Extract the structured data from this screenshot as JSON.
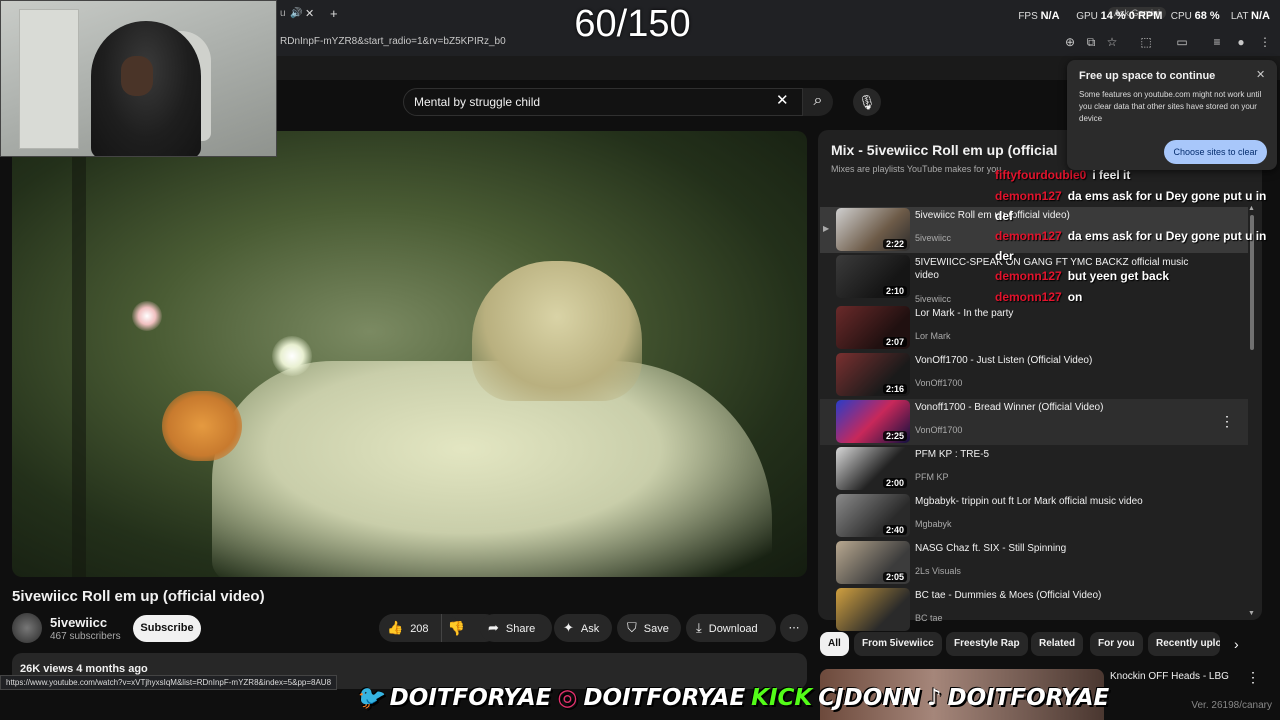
{
  "browser": {
    "url": "RDnInpF-mYZR8&start_radio=1&rv=bZ5KPIRz_b0",
    "tab_partial": "u",
    "status_url": "https://www.youtube.com/watch?v=xVTjhyxsIqM&list=RDnInpF-mYZR8&index=5&pp=8AU8"
  },
  "overlay": {
    "counter": "60/150",
    "ask_gemini": "Ask Gemini",
    "fps_label": "FPS",
    "fps_value": "N/A",
    "gpu_label": "GPU",
    "gpu_value": "14 % 0 RPM",
    "cpu_label": "CPU",
    "cpu_value": "68 %",
    "lat_label": "LAT",
    "lat_value": "N/A",
    "version": "Ver. 26198/canary",
    "socials": [
      {
        "icon": "twitter-icon",
        "glyph": "🐦",
        "text": "DOITFORYAE"
      },
      {
        "icon": "instagram-icon",
        "glyph": "◎",
        "text": "DOITFORYAE"
      },
      {
        "icon": "kick-icon",
        "glyph": "KICK",
        "text": "CJDONN"
      },
      {
        "icon": "tiktok-icon",
        "glyph": "♪",
        "text": "DOITFORYAE"
      }
    ]
  },
  "search": {
    "query": "Mental by struggle child"
  },
  "video": {
    "title": "5ivewiicc Roll em up (official video)",
    "channel": "5ivewiicc",
    "subscribers": "467 subscribers",
    "subscribe_label": "Subscribe",
    "likes": "208",
    "share_label": "Share",
    "ask_label": "Ask",
    "save_label": "Save",
    "download_label": "Download",
    "views_date": "26K views  4 months ago"
  },
  "playlist": {
    "title": "Mix - 5ivewiicc Roll em up (official vi",
    "subtitle": "Mixes are playlists YouTube makes for you",
    "items": [
      {
        "title": "5ivewiicc Roll em up (official video)",
        "channel": "5ivewiicc",
        "duration": "2:22"
      },
      {
        "title": "5IVEWIICC-SPEAK ON GANG FT YMC BACKZ official music video",
        "channel": "5ivewiicc",
        "duration": "2:10"
      },
      {
        "title": "Lor Mark - In the party",
        "channel": "Lor Mark",
        "duration": "2:07"
      },
      {
        "title": "VonOff1700 - Just Listen (Official Video)",
        "channel": "VonOff1700",
        "duration": "2:16"
      },
      {
        "title": "Vonoff1700 - Bread Winner (Official Video)",
        "channel": "VonOff1700",
        "duration": "2:25"
      },
      {
        "title": "PFM KP : TRE-5",
        "channel": "PFM KP",
        "duration": "2:00"
      },
      {
        "title": "Mgbabyk- trippin out ft Lor Mark official music video",
        "channel": "Mgbabyk",
        "duration": "2:40"
      },
      {
        "title": "NASG Chaz ft. SIX - Still Spinning",
        "channel": "2Ls Visuals",
        "duration": "2:05"
      },
      {
        "title": "BC tae - Dummies & Moes (Official Video)",
        "channel": "BC tae",
        "duration": ""
      }
    ]
  },
  "chat": [
    {
      "user": "fiftyfourdouble0",
      "message": "i feel it"
    },
    {
      "user": "demonn127",
      "message": "da ems ask for u Dey gone put u in def"
    },
    {
      "user": "demonn127",
      "message": "da ems ask for u Dey gone put u in der"
    },
    {
      "user": "demonn127",
      "message": "but yeen get back"
    },
    {
      "user": "demonn127",
      "message": "on"
    }
  ],
  "popup": {
    "title": "Free up space to continue",
    "body": "Some features on youtube.com might not work until you clear data that other sites have stored on your device",
    "button": "Choose sites to clear"
  },
  "chips": [
    "All",
    "From 5ivewiicc",
    "Freestyle Rap",
    "Related",
    "For you",
    "Recently uplo"
  ],
  "next_video": {
    "title": "Knockin OFF Heads - LBG"
  }
}
